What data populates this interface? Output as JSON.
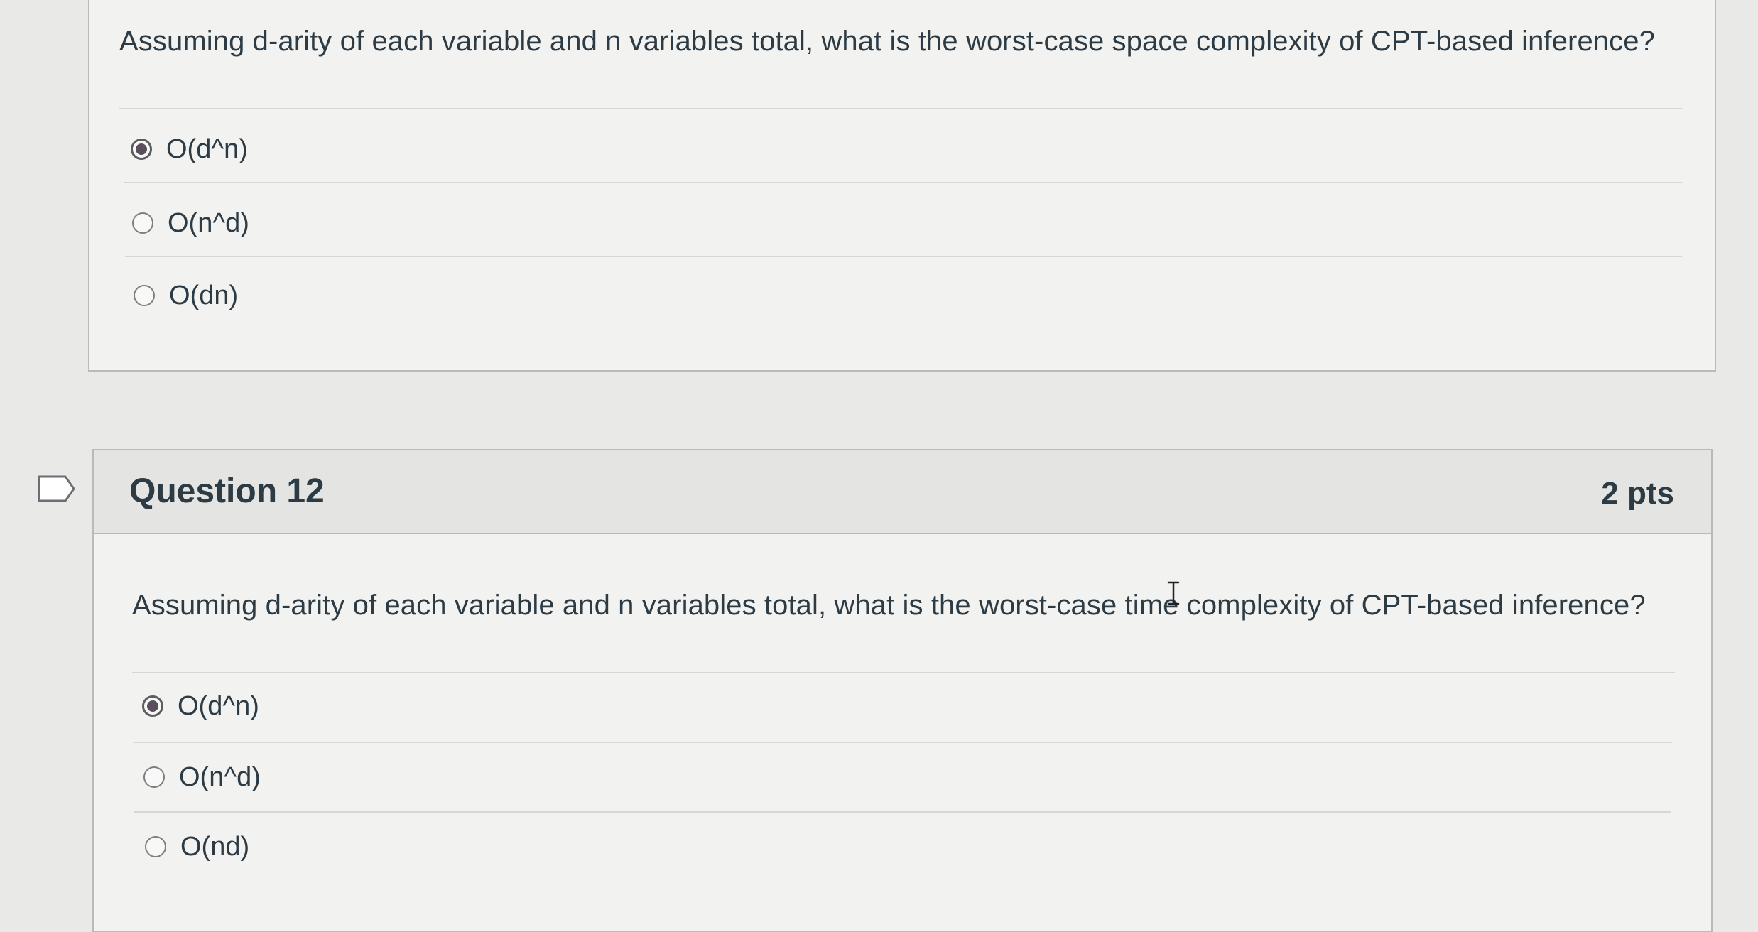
{
  "previous_question": {
    "text": "Assuming d-arity of each variable and n variables total, what is the worst-case space complexity of CPT-based inference?",
    "answers": [
      {
        "label": "O(d^n)",
        "selected": true
      },
      {
        "label": "O(n^d)",
        "selected": false
      },
      {
        "label": "O(dn)",
        "selected": false
      }
    ]
  },
  "question_12": {
    "title": "Question 12",
    "points": "2 pts",
    "text": "Assuming d-arity of each variable and n variables total, what is the worst-case time complexity of CPT-based inference?",
    "answers": [
      {
        "label": "O(d^n)",
        "selected": true
      },
      {
        "label": "O(n^d)",
        "selected": false
      },
      {
        "label": "O(nd)",
        "selected": false
      }
    ]
  },
  "icons": {
    "flag": "flag-question-icon",
    "cursor": "text-cursor-icon"
  },
  "colors": {
    "card_background": "#f2f2f0",
    "header_background": "#e4e4e2",
    "text": "#2d3b45",
    "selected_radio": "#5b4f5e"
  }
}
